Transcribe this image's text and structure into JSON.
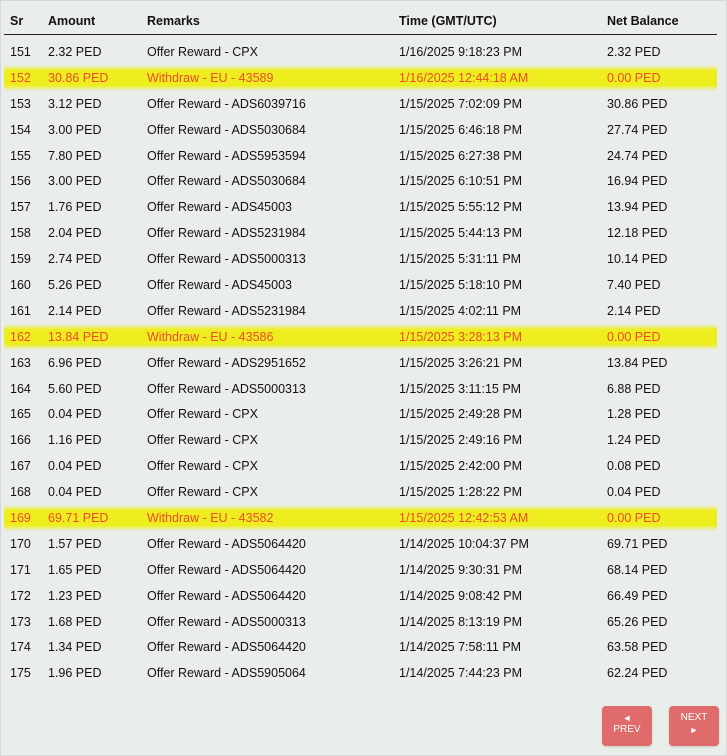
{
  "table": {
    "headers": {
      "sr": "Sr",
      "amount": "Amount",
      "remarks": "Remarks",
      "time": "Time (GMT/UTC)",
      "balance": "Net Balance"
    },
    "rows": [
      {
        "sr": "151",
        "amount": "2.32 PED",
        "remarks": "Offer Reward - CPX",
        "time": "1/16/2025 9:18:23 PM",
        "balance": "2.32 PED",
        "withdraw": false
      },
      {
        "sr": "152",
        "amount": "30.86 PED",
        "remarks": "Withdraw - EU - 43589",
        "time": "1/16/2025 12:44:18 AM",
        "balance": "0.00 PED",
        "withdraw": true
      },
      {
        "sr": "153",
        "amount": "3.12 PED",
        "remarks": "Offer Reward - ADS6039716",
        "time": "1/15/2025 7:02:09 PM",
        "balance": "30.86 PED",
        "withdraw": false
      },
      {
        "sr": "154",
        "amount": "3.00 PED",
        "remarks": "Offer Reward - ADS5030684",
        "time": "1/15/2025 6:46:18 PM",
        "balance": "27.74 PED",
        "withdraw": false
      },
      {
        "sr": "155",
        "amount": "7.80 PED",
        "remarks": "Offer Reward - ADS5953594",
        "time": "1/15/2025 6:27:38 PM",
        "balance": "24.74 PED",
        "withdraw": false
      },
      {
        "sr": "156",
        "amount": "3.00 PED",
        "remarks": "Offer Reward - ADS5030684",
        "time": "1/15/2025 6:10:51 PM",
        "balance": "16.94 PED",
        "withdraw": false
      },
      {
        "sr": "157",
        "amount": "1.76 PED",
        "remarks": "Offer Reward - ADS45003",
        "time": "1/15/2025 5:55:12 PM",
        "balance": "13.94 PED",
        "withdraw": false
      },
      {
        "sr": "158",
        "amount": "2.04 PED",
        "remarks": "Offer Reward - ADS5231984",
        "time": "1/15/2025 5:44:13 PM",
        "balance": "12.18 PED",
        "withdraw": false
      },
      {
        "sr": "159",
        "amount": "2.74 PED",
        "remarks": "Offer Reward - ADS5000313",
        "time": "1/15/2025 5:31:11 PM",
        "balance": "10.14 PED",
        "withdraw": false
      },
      {
        "sr": "160",
        "amount": "5.26 PED",
        "remarks": "Offer Reward - ADS45003",
        "time": "1/15/2025 5:18:10 PM",
        "balance": "7.40 PED",
        "withdraw": false
      },
      {
        "sr": "161",
        "amount": "2.14 PED",
        "remarks": "Offer Reward - ADS5231984",
        "time": "1/15/2025 4:02:11 PM",
        "balance": "2.14 PED",
        "withdraw": false
      },
      {
        "sr": "162",
        "amount": "13.84 PED",
        "remarks": "Withdraw - EU - 43586",
        "time": "1/15/2025 3:28:13 PM",
        "balance": "0.00 PED",
        "withdraw": true
      },
      {
        "sr": "163",
        "amount": "6.96 PED",
        "remarks": "Offer Reward - ADS2951652",
        "time": "1/15/2025 3:26:21 PM",
        "balance": "13.84 PED",
        "withdraw": false
      },
      {
        "sr": "164",
        "amount": "5.60 PED",
        "remarks": "Offer Reward - ADS5000313",
        "time": "1/15/2025 3:11:15 PM",
        "balance": "6.88 PED",
        "withdraw": false
      },
      {
        "sr": "165",
        "amount": "0.04 PED",
        "remarks": "Offer Reward - CPX",
        "time": "1/15/2025 2:49:28 PM",
        "balance": "1.28 PED",
        "withdraw": false
      },
      {
        "sr": "166",
        "amount": "1.16 PED",
        "remarks": "Offer Reward - CPX",
        "time": "1/15/2025 2:49:16 PM",
        "balance": "1.24 PED",
        "withdraw": false
      },
      {
        "sr": "167",
        "amount": "0.04 PED",
        "remarks": "Offer Reward - CPX",
        "time": "1/15/2025 2:42:00 PM",
        "balance": "0.08 PED",
        "withdraw": false
      },
      {
        "sr": "168",
        "amount": "0.04 PED",
        "remarks": "Offer Reward - CPX",
        "time": "1/15/2025 1:28:22 PM",
        "balance": "0.04 PED",
        "withdraw": false
      },
      {
        "sr": "169",
        "amount": "69.71 PED",
        "remarks": "Withdraw - EU - 43582",
        "time": "1/15/2025 12:42:53 AM",
        "balance": "0.00 PED",
        "withdraw": true
      },
      {
        "sr": "170",
        "amount": "1.57 PED",
        "remarks": "Offer Reward - ADS5064420",
        "time": "1/14/2025 10:04:37 PM",
        "balance": "69.71 PED",
        "withdraw": false
      },
      {
        "sr": "171",
        "amount": "1.65 PED",
        "remarks": "Offer Reward - ADS5064420",
        "time": "1/14/2025 9:30:31 PM",
        "balance": "68.14 PED",
        "withdraw": false
      },
      {
        "sr": "172",
        "amount": "1.23 PED",
        "remarks": "Offer Reward - ADS5064420",
        "time": "1/14/2025 9:08:42 PM",
        "balance": "66.49 PED",
        "withdraw": false
      },
      {
        "sr": "173",
        "amount": "1.68 PED",
        "remarks": "Offer Reward - ADS5000313",
        "time": "1/14/2025 8:13:19 PM",
        "balance": "65.26 PED",
        "withdraw": false
      },
      {
        "sr": "174",
        "amount": "1.34 PED",
        "remarks": "Offer Reward - ADS5064420",
        "time": "1/14/2025 7:58:11 PM",
        "balance": "63.58 PED",
        "withdraw": false
      },
      {
        "sr": "175",
        "amount": "1.96 PED",
        "remarks": "Offer Reward - ADS5905064",
        "time": "1/14/2025 7:44:23 PM",
        "balance": "62.24 PED",
        "withdraw": false
      }
    ]
  },
  "pagination": {
    "prev_arrow": "◄",
    "prev_label": "PREV",
    "next_label": "NEXT",
    "next_arrow": "►"
  },
  "colors": {
    "withdraw_text": "#ef4a2a",
    "highlight": "#eeee14",
    "button_bg": "#e06b6b",
    "page_bg": "#e9eeea"
  }
}
